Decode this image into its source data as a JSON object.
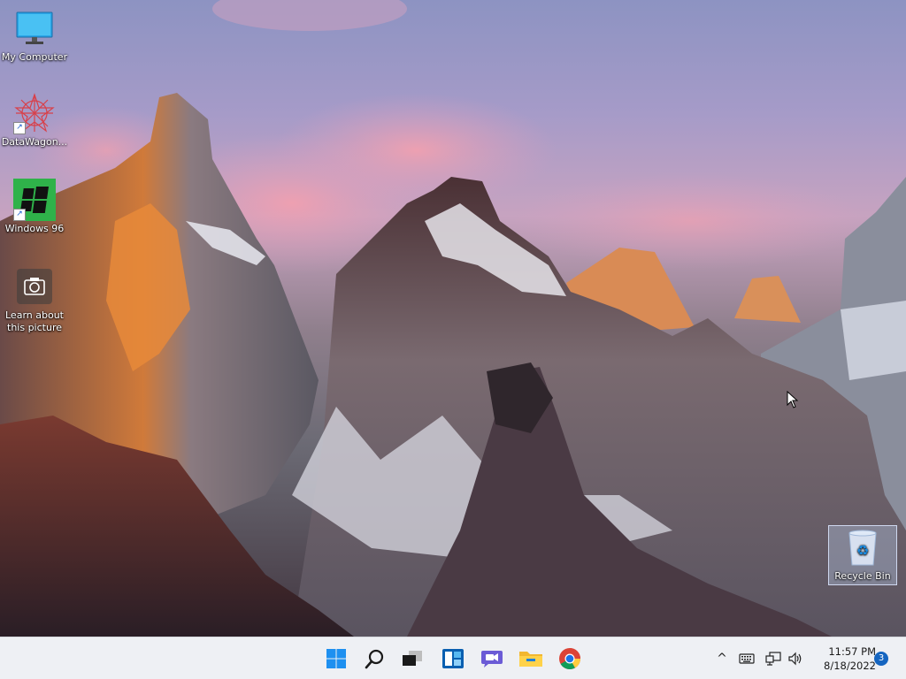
{
  "desktop": {
    "icons": [
      {
        "label": "My Computer",
        "icon": "monitor-icon"
      },
      {
        "label": "DataWagon...",
        "icon": "datawagon-icon"
      },
      {
        "label": "Windows 96",
        "icon": "windows-96-icon"
      },
      {
        "label": "Learn about this picture",
        "icon": "camera-icon"
      }
    ],
    "recycle_bin": {
      "label": "Recycle Bin",
      "icon": "recycle-bin-icon"
    }
  },
  "taskbar": {
    "apps": [
      {
        "name": "Start",
        "icon": "windows-start-icon"
      },
      {
        "name": "Search",
        "icon": "search-icon"
      },
      {
        "name": "Task View",
        "icon": "task-view-icon"
      },
      {
        "name": "Widgets",
        "icon": "widgets-icon"
      },
      {
        "name": "Chat",
        "icon": "chat-icon"
      },
      {
        "name": "File Explorer",
        "icon": "folder-icon"
      },
      {
        "name": "Chrome",
        "icon": "chrome-icon"
      }
    ],
    "tray": {
      "chevron": "^",
      "time": "11:57 PM",
      "date": "8/18/2022",
      "notifications": "3"
    }
  },
  "colors": {
    "accent": "#0067c0",
    "taskbar_bg": "#eef0f4",
    "sky_top": "#8d93c2",
    "cloud_pink": "#e89ab0"
  }
}
